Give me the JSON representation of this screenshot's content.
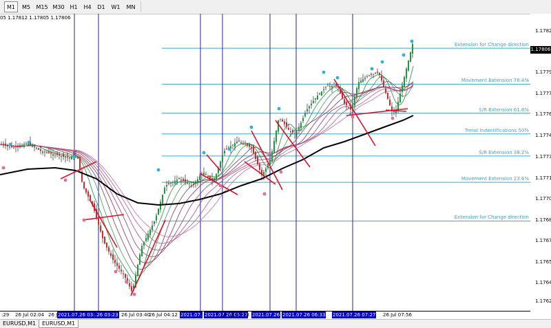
{
  "timeframes": [
    "M1",
    "M5",
    "M15",
    "M30",
    "H1",
    "H4",
    "D1",
    "W1",
    "MN"
  ],
  "active_timeframe": "M1",
  "quote_header": "05 1.17812 1.17805 1.17806",
  "price_axis": {
    "labels": [
      "1.17820",
      "1.17790",
      "1.17775",
      "1.17760",
      "1.17745",
      "1.17730",
      "1.17715",
      "1.17700",
      "1.17685",
      "1.17670",
      "1.17655",
      "1.17640",
      "1.17625"
    ],
    "current_price": "1.17806"
  },
  "levels": [
    {
      "label": "Extension for Change direction",
      "price": 1.17808
    },
    {
      "label": "Movement Extension   76.4%",
      "price": 1.17782
    },
    {
      "label": "S/R Extension     61.8%",
      "price": 1.17761
    },
    {
      "label": "Trend Indentifications  50%",
      "price": 1.17746
    },
    {
      "label": "S/R Extension     38.2%",
      "price": 1.1773
    },
    {
      "label": "Movement Extension    23.6%",
      "price": 1.17711
    },
    {
      "label": "Extension for Change direction",
      "price": 1.17683
    }
  ],
  "time_axis": [
    {
      "text": ":29",
      "hl": false
    },
    {
      "text": "26 Jul 02:04",
      "hl": false
    },
    {
      "text": "26 Jul 02:35",
      "hl": false
    },
    {
      "text": "2021.07.26 03:01",
      "hl": true
    },
    {
      "text": ".26 03:23",
      "hl": true
    },
    {
      "text": "26 Jul 03:40",
      "hl": false
    },
    {
      "text": "26 Jul 04:12",
      "hl": false
    },
    {
      "text": "2021.07.",
      "hl": true
    },
    {
      "text": "2021.07.26 05:22",
      "hl": true
    },
    {
      "text": "26 Jul 05:53",
      "hl": false
    },
    {
      "text": "2021.07.26",
      "hl": true
    },
    {
      "text": "2021.07.26 06:33",
      "hl": true
    },
    {
      "text": "2021.07.26 07:27",
      "hl": true
    },
    {
      "text": "26 Jul 07:56",
      "hl": false
    }
  ],
  "tabs": [
    "EURUSD,M1",
    "EURUSD,M1"
  ],
  "active_tab": 1,
  "colors": {
    "vline": "#23239a",
    "level": "#3aa6c8",
    "ma": "#000000",
    "trend": "#e0102a",
    "bull": "#1a9a3a",
    "bear": "#d42a2a",
    "fractal_up": "#2ab4dc",
    "fractal_down": "#e07090",
    "highlight": "#0000c8"
  }
}
